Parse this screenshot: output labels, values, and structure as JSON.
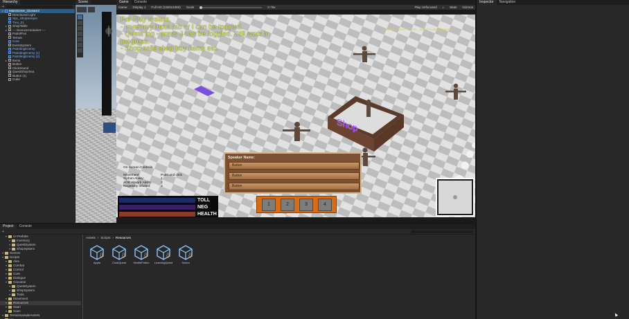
{
  "hierarchy": {
    "tab": "Hierarchy",
    "items": [
      {
        "label": "MainScene_Giovanni",
        "depth": 0,
        "type": "scene"
      },
      {
        "label": "Directional Light",
        "depth": 1,
        "type": "obj"
      },
      {
        "label": "Npc_ShopKeeper",
        "depth": 1,
        "type": "prefab"
      },
      {
        "label": "Trex_01",
        "depth": 1,
        "type": "prefab"
      },
      {
        "label": "ShopTable",
        "depth": 1,
        "type": "obj"
      },
      {
        "label": "----ScenceContainer----",
        "depth": 1,
        "type": "obj"
      },
      {
        "label": "PatrolPos",
        "depth": 1,
        "type": "obj"
      },
      {
        "label": "Terrain",
        "depth": 1,
        "type": "obj"
      },
      {
        "label": "Core",
        "depth": 1,
        "type": "prefab"
      },
      {
        "label": "EventSystem",
        "depth": 1,
        "type": "obj"
      },
      {
        "label": "PatrolingEnemy",
        "depth": 1,
        "type": "prefab"
      },
      {
        "label": "PatrolingEnemy (1)",
        "depth": 1,
        "type": "prefab"
      },
      {
        "label": "PatrolingEnemy (2)",
        "depth": 1,
        "type": "prefab"
      },
      {
        "label": "Items",
        "depth": 1,
        "type": "obj"
      },
      {
        "label": "Button",
        "depth": 1,
        "type": "obj"
      },
      {
        "label": "ClickSound",
        "depth": 1,
        "type": "obj"
      },
      {
        "label": "QuestShopText",
        "depth": 1,
        "type": "obj"
      },
      {
        "label": "Button (1)",
        "depth": 1,
        "type": "obj"
      },
      {
        "label": "Cube",
        "depth": 1,
        "type": "obj"
      }
    ]
  },
  "scene_tab": "Scene",
  "game": {
    "tab": "Game",
    "console_tab": "Console",
    "toolbar": {
      "mode": "Game",
      "display": "Display 1",
      "resolution": "Full HD (1920x1080)",
      "scale_label": "Scale",
      "scale_value": "0.75x",
      "play_mode": "Play Unfocused",
      "stats": "Stats",
      "gizmos": "Gizmos"
    },
    "notes": [
      "For Play testers,",
      "- Inventory input tab or I can be toggled.",
      "- Quest log - press J can be toggled. Still work in",
      "progress.",
      "- Shop sells shop buy items etc."
    ],
    "quest_hint": "Collected Sticks: 1/3/10 . Talked to shopkeeper: 0/1",
    "shop_sign": "Shop",
    "controls": {
      "title": "On Screen Controls",
      "rows": [
        {
          "label": "Movement:",
          "value": "Point and click"
        },
        {
          "label": "Siphon Ability:",
          "value": "1"
        },
        {
          "label": "AOE Absorb Ability:",
          "value": "2"
        },
        {
          "label": "Negativity Infused:",
          "value": "3"
        }
      ]
    },
    "bars": [
      {
        "label": "TOLL",
        "color": "#1b2a6b"
      },
      {
        "label": "NEG",
        "color": "#3a1f66"
      },
      {
        "label": "HEALTH",
        "color": "#8a3b2c"
      }
    ],
    "dialog": {
      "speaker": "Speaker Name:",
      "buttons": [
        "Button",
        "Button",
        "Button"
      ]
    },
    "hotbar": [
      "1",
      "2",
      "3",
      "4"
    ]
  },
  "inspector": {
    "tab": "Inspector",
    "nav_tab": "Navigation"
  },
  "project": {
    "tab": "Project",
    "console_tab": "Console",
    "breadcrumb": [
      "Assets",
      "Scripts",
      "Resources"
    ],
    "tree": [
      {
        "label": "UI Prefabs",
        "depth": 1
      },
      {
        "label": "Inventory",
        "depth": 2
      },
      {
        "label": "QuestSystem",
        "depth": 2
      },
      {
        "label": "ShopSystem",
        "depth": 2
      },
      {
        "label": "Scenes",
        "depth": 0
      },
      {
        "label": "Scripts",
        "depth": 0
      },
      {
        "label": "Alex",
        "depth": 1
      },
      {
        "label": "Combat",
        "depth": 1
      },
      {
        "label": "Control",
        "depth": 1
      },
      {
        "label": "Core",
        "depth": 1
      },
      {
        "label": "Dialogue",
        "depth": 1
      },
      {
        "label": "Giovanni",
        "depth": 1
      },
      {
        "label": "QuestSystem",
        "depth": 2
      },
      {
        "label": "ShopSystem",
        "depth": 2
      },
      {
        "label": "Tools",
        "depth": 2
      },
      {
        "label": "Movement",
        "depth": 1
      },
      {
        "label": "Resources",
        "depth": 1,
        "selected": true
      },
      {
        "label": "Saari",
        "depth": 1
      },
      {
        "label": "Soon",
        "depth": 1
      },
      {
        "label": "TerrainSampleAssets",
        "depth": 0
      },
      {
        "label": "UI",
        "depth": 0
      }
    ],
    "assets": [
      "Apple",
      "CookQuest",
      "HealthPotion",
      "LearningQuest",
      "Sword"
    ]
  },
  "colors": {
    "accent_select": "#2c5d87",
    "hud_yellow": "#e3f05a",
    "shop_text": "#9b3cff",
    "dialog_bg": "#7a5233"
  }
}
